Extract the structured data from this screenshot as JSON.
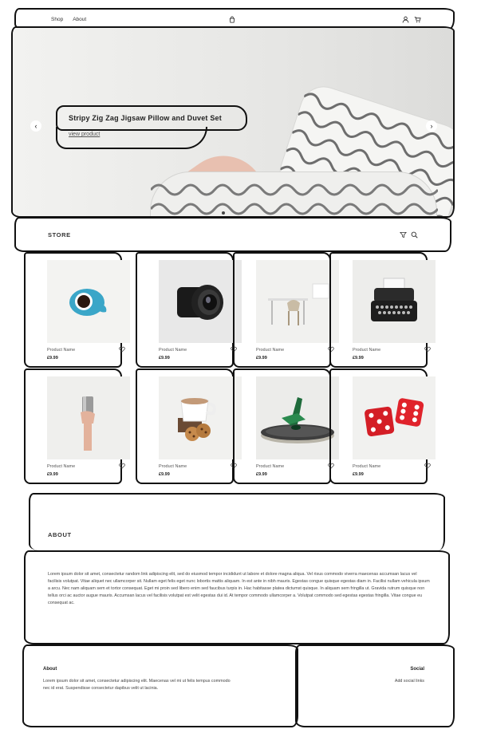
{
  "header": {
    "nav": [
      "Shop",
      "About"
    ],
    "icons": [
      "bag-icon",
      "user-icon",
      "cart-icon"
    ]
  },
  "hero": {
    "title": "Stripy Zig Zag Jigsaw Pillow and Duvet Set",
    "link": "view product",
    "prev": "‹",
    "next": "›"
  },
  "store": {
    "title": "STORE",
    "icons": [
      "filter-icon",
      "search-icon"
    ]
  },
  "products": [
    {
      "name": "Product Name",
      "price": "£9.99",
      "image": "blue-cup"
    },
    {
      "name": "Product Name",
      "price": "£9.99",
      "image": "camera-lens"
    },
    {
      "name": "Product Name",
      "price": "£9.99",
      "image": "desk"
    },
    {
      "name": "Product Name",
      "price": "£9.99",
      "image": "typewriter"
    },
    {
      "name": "Product Name",
      "price": "£9.99",
      "image": "metal-cup"
    },
    {
      "name": "Product Name",
      "price": "£9.99",
      "image": "coffee-cookies"
    },
    {
      "name": "Product Name",
      "price": "£9.99",
      "image": "spinning-top"
    },
    {
      "name": "Product Name",
      "price": "£9.99",
      "image": "red-dice"
    }
  ],
  "about": {
    "title": "ABOUT",
    "text": "Lorem ipsum dolor sit amet, consectetur random link adipiscing elit, sed do eiusmod tempor incididunt ut labore et dolore magna aliqua. Vel risus commodo viverra maecenas accumsan lacus vel facilisis volutpat. Vitae aliquet nec ullamcorper sit. Nullam eget felis eget nunc lobortis mattis aliquam. In est ante in nibh mauris. Egestas congue quisque egestas diam in. Facilisi nullam vehicula ipsum a arcu. Nec nam aliquam sem et tortor consequat. Eget mi proin sed libero enim sed faucibus turpis in. Hac habitasse platea dictumst quisque. In aliquam sem fringilla ut. Gravida rutrum quisque non tellus orci ac auctor augue mauris. Accumsan lacus vel facilisis volutpat est velit egestas dui id. At tempor commodo ullamcorper a. Volutpat commodo sed egestas egestas fringilla. Vitae congue eu consequat ac."
  },
  "footer": {
    "about_title": "About",
    "about_text": "Lorem ipsum dolor sit amet, consectetur adipiscing elit. Maecenas vel mi ut felis tempus commodo nec id erat. Suspendisse consectetur dapibus velit ut lacinia.",
    "social_title": "Social",
    "social_link": "Add social links"
  }
}
